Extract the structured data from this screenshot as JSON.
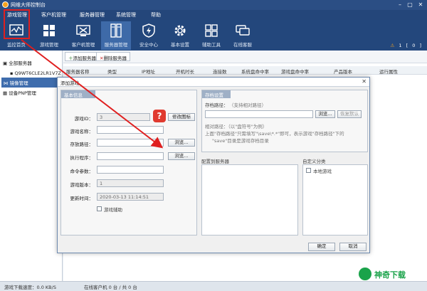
{
  "titlebar": {
    "title": "网维大师控制台"
  },
  "menu": [
    "游戏管理",
    "客户机管理",
    "服务器管理",
    "系统管理",
    "帮助"
  ],
  "toolbar": {
    "items": [
      "监控首页",
      "游戏管理",
      "客户机管理",
      "服务器管理",
      "安全中心",
      "基本设置",
      "辅助工具",
      "在线客服"
    ],
    "active_index": 3,
    "right_text": [
      "⚠",
      "1",
      "[",
      "0",
      "]"
    ]
  },
  "leftpanel": {
    "items": [
      "全部服务器",
      "Q9WT6CLE2LR1V7Z（",
      "镜像管理",
      "设备PNP管理"
    ],
    "selected_index": 2
  },
  "main": {
    "add_server": "添加服务器",
    "delete_server": "删除服务器",
    "columns": [
      "服务器名称",
      "类型",
      "IP地址",
      "开机时长",
      "连接数",
      "系统盘命中率",
      "游戏盘命中率",
      "产品版本",
      "运行属性"
    ]
  },
  "dialog": {
    "title": "添加游戏",
    "basic_info": "基本信息",
    "game_id_label": "游戏ID：",
    "game_id_value": "3",
    "modify_icon": "修改图标",
    "game_name_label": "游戏名称：",
    "store_path_label": "存放路径：",
    "exe_label": "执行程序：",
    "browse": "浏览...",
    "cmd_label": "命令参数：",
    "version_label": "游戏版本：",
    "version_value": "1",
    "update_time_label": "更新时间：",
    "update_time_value": "2020-03-13 11:14:51",
    "assist_game": "游戏辅助",
    "store_settings": "存档设置",
    "store_path2_label": "存档路径：",
    "store_path2_hint": "（支持相对路径）",
    "browse2": "浏览...",
    "restore_default": "恢复默认",
    "relative_path_hint": "相对路径：（以\"盘符号\"为例）",
    "relative_path_line2": "上面\"存档路径\"只需填写\"\\save\\*.*\"即可，表示游戏\"存档路径\"下的",
    "relative_path_line3": "\"save\"目录是游戏存档目录",
    "assign_servers": "配置到服务器",
    "custom_category": "自定义分类",
    "local_game": "本地游戏",
    "ok": "确定",
    "cancel": "取消"
  },
  "statusbar": {
    "download_speed": "游戏下载速度：0.0 KB/S",
    "online_clients": "在线客户机 0 台 / 共 0 台"
  },
  "watermark": {
    "text": "神奇下载"
  },
  "colors": {
    "accent_blue": "#23477c",
    "highlight_red": "#e01f1f"
  }
}
